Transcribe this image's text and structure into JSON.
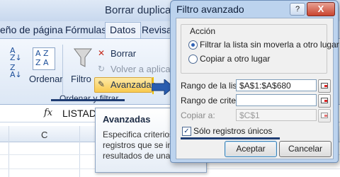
{
  "excel": {
    "window_title": "Borrar duplicados.xlsx - Microsoft Ex",
    "tabs": [
      "eño de página",
      "Fórmulas",
      "Datos",
      "Revisar"
    ],
    "ribbon": {
      "ordenar_label": "Ordenar",
      "filtro_label": "Filtro",
      "borrar_label": "Borrar",
      "volver_label": "Volver a aplicar",
      "avanzadas_label": "Avanzadas",
      "group_label": "Ordenar y filtrar"
    },
    "formula_bar": {
      "fx": "fx",
      "value": "LISTADO"
    },
    "column_header": "C"
  },
  "tooltip": {
    "title": "Avanzadas",
    "lines": [
      "Especifica criterios",
      "registros que se in",
      "resultados de una"
    ]
  },
  "dialog": {
    "title": "Filtro avanzado",
    "help": "?",
    "close": "X",
    "accion_label": "Acción",
    "option_filter": "Filtrar la lista sin moverla a otro lugar",
    "option_copy": "Copiar a otro lugar",
    "rango_lista_label": "Rango de la lista:",
    "rango_lista_value": "$A$1:$A$680",
    "rango_criterios_label": "Rango de criterios:",
    "rango_criterios_value": "",
    "copiar_label": "Copiar a:",
    "copiar_value": "$C$1",
    "unique_label": "Sólo registros únicos",
    "accept": "Aceptar",
    "cancel": "Cancelar"
  }
}
